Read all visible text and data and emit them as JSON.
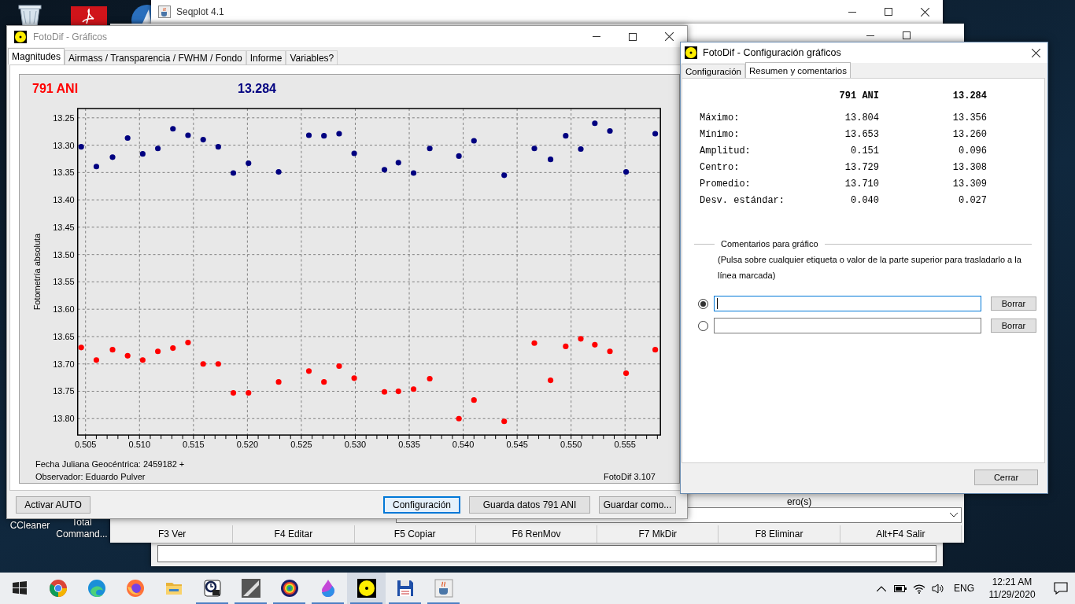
{
  "desktop": {
    "icons": [
      {
        "kind": "trash"
      },
      {
        "kind": "document"
      },
      {
        "kind": "app"
      }
    ],
    "labels": [
      {
        "label": "CCleaner"
      },
      {
        "label": "Total Command..."
      }
    ]
  },
  "seqplot_window": {
    "title": "Seqplot 4.1"
  },
  "file_manager_window": {
    "status_text": "ero(s)",
    "function_keys": [
      "F3 Ver",
      "F4 Editar",
      "F5 Copiar",
      "F6 RenMov",
      "F7 MkDir",
      "F8 Eliminar",
      "Alt+F4 Salir"
    ]
  },
  "graphs_window": {
    "title": "FotoDif - Gráficos",
    "active": false,
    "tabs": [
      {
        "label": "Magnitudes",
        "selected": true
      },
      {
        "label": "Airmass / Transparencia / FWHM / Fondo",
        "selected": false
      },
      {
        "label": "Informe",
        "selected": false
      },
      {
        "label": "Variables?",
        "selected": false
      }
    ],
    "chart_data": {
      "type": "scatter",
      "grid": true,
      "xlabel": "Fecha Juliana Geocéntrica: 2459182 +",
      "ylabel": "Fotometría absoluta",
      "xlim": [
        0.50427,
        0.55828
      ],
      "ylim": [
        13.83,
        13.233
      ],
      "xticks": [
        {
          "value": 0.505,
          "label": "0.505"
        },
        {
          "value": 0.51,
          "label": "0.510"
        },
        {
          "value": 0.515,
          "label": "0.515"
        },
        {
          "value": 0.52,
          "label": "0.520"
        },
        {
          "value": 0.525,
          "label": "0.525"
        },
        {
          "value": 0.53,
          "label": "0.530"
        },
        {
          "value": 0.535,
          "label": "0.535"
        },
        {
          "value": 0.54,
          "label": "0.540"
        },
        {
          "value": 0.545,
          "label": "0.545"
        },
        {
          "value": 0.55,
          "label": "0.550"
        },
        {
          "value": 0.555,
          "label": "0.555"
        }
      ],
      "yticks": [
        {
          "value": 13.25,
          "label": "13.25"
        },
        {
          "value": 13.3,
          "label": "13.30"
        },
        {
          "value": 13.35,
          "label": "13.35"
        },
        {
          "value": 13.4,
          "label": "13.40"
        },
        {
          "value": 13.45,
          "label": "13.45"
        },
        {
          "value": 13.5,
          "label": "13.50"
        },
        {
          "value": 13.55,
          "label": "13.55"
        },
        {
          "value": 13.6,
          "label": "13.60"
        },
        {
          "value": 13.65,
          "label": "13.65"
        },
        {
          "value": 13.7,
          "label": "13.70"
        },
        {
          "value": 13.75,
          "label": "13.75"
        },
        {
          "value": 13.8,
          "label": "13.80"
        }
      ],
      "x": [
        0.5046,
        0.506,
        0.5075,
        0.5089,
        0.5103,
        0.5117,
        0.5131,
        0.5145,
        0.5159,
        0.5173,
        0.5187,
        0.5201,
        0.5229,
        0.5257,
        0.5271,
        0.5285,
        0.5299,
        0.5327,
        0.534,
        0.5354,
        0.5369,
        0.5396,
        0.541,
        0.5438,
        0.5466,
        0.5481,
        0.5495,
        0.5509,
        0.5522,
        0.5536,
        0.5551,
        0.5578
      ],
      "series": [
        {
          "name": "791 ANI",
          "color": "#ff0000",
          "values": [
            13.67,
            13.693,
            13.674,
            13.685,
            13.693,
            13.677,
            13.671,
            13.661,
            13.7,
            13.7,
            13.753,
            13.753,
            13.733,
            13.713,
            13.733,
            13.704,
            13.726,
            13.751,
            13.75,
            13.746,
            13.727,
            13.8,
            13.766,
            13.805,
            13.662,
            13.73,
            13.668,
            13.654,
            13.665,
            13.677,
            13.717,
            13.674
          ]
        },
        {
          "name": "13.284",
          "color": "#000080",
          "values": [
            13.303,
            13.339,
            13.322,
            13.287,
            13.316,
            13.306,
            13.27,
            13.282,
            13.29,
            13.303,
            13.351,
            13.333,
            13.349,
            13.282,
            13.283,
            13.279,
            13.315,
            13.345,
            13.332,
            13.351,
            13.306,
            13.32,
            13.292,
            13.355,
            13.306,
            13.326,
            13.283,
            13.307,
            13.26,
            13.274,
            13.349,
            13.279
          ]
        }
      ]
    },
    "observer": "Observador: Eduardo Pulver",
    "version": "FotoDif 3.107",
    "buttons": [
      {
        "label": "Activar AUTO",
        "focused": false
      },
      {
        "label": "Configuración",
        "focused": true
      },
      {
        "label": "Guarda datos 791 ANI",
        "focused": false
      },
      {
        "label": "Guardar como...",
        "focused": false
      }
    ]
  },
  "config_window": {
    "title": "FotoDif - Configuración gráficos",
    "active": true,
    "tabs": [
      {
        "label": "Configuración",
        "selected": false
      },
      {
        "label": "Resumen y comentarios",
        "selected": true
      }
    ],
    "summary": {
      "columns": [
        "791 ANI",
        "13.284"
      ],
      "rows": [
        {
          "label": "Máximo:",
          "values": [
            "13.804",
            "13.356"
          ]
        },
        {
          "label": "Mínimo:",
          "values": [
            "13.653",
            "13.260"
          ]
        },
        {
          "label": "Amplitud:",
          "values": [
            "0.151",
            "0.096"
          ]
        },
        {
          "label": "Centro:",
          "values": [
            "13.729",
            "13.308"
          ]
        },
        {
          "label": "Promedio:",
          "values": [
            "13.710",
            "13.309"
          ]
        },
        {
          "label": "Desv. estándar:",
          "values": [
            "0.040",
            "0.027"
          ]
        }
      ]
    },
    "comments": {
      "legend": "Comentarios para gráfico",
      "hint": "(Pulsa sobre cualquier etiqueta o valor de la parte superior para trasladarlo a la línea marcada)",
      "lines": [
        {
          "selected": true,
          "button": "Borrar"
        },
        {
          "selected": false,
          "button": "Borrar"
        }
      ]
    },
    "close_button": "Cerrar"
  },
  "taskbar": {
    "apps": [
      {
        "kind": "start",
        "running": false,
        "selected": false
      },
      {
        "kind": "chrome",
        "running": false,
        "selected": false
      },
      {
        "kind": "edge",
        "running": false,
        "selected": false
      },
      {
        "kind": "firefox",
        "running": false,
        "selected": false
      },
      {
        "kind": "folder",
        "running": false,
        "selected": false
      },
      {
        "kind": "clock",
        "running": true,
        "selected": false
      },
      {
        "kind": "image",
        "running": true,
        "selected": false
      },
      {
        "kind": "wheel",
        "running": true,
        "selected": false
      },
      {
        "kind": "drop",
        "running": true,
        "selected": false
      },
      {
        "kind": "dot",
        "running": true,
        "selected": true
      },
      {
        "kind": "floppy",
        "running": true,
        "selected": false
      },
      {
        "kind": "cup",
        "running": true,
        "selected": false
      }
    ],
    "language": "ENG",
    "time": "12:21 AM",
    "date": "11/29/2020"
  }
}
